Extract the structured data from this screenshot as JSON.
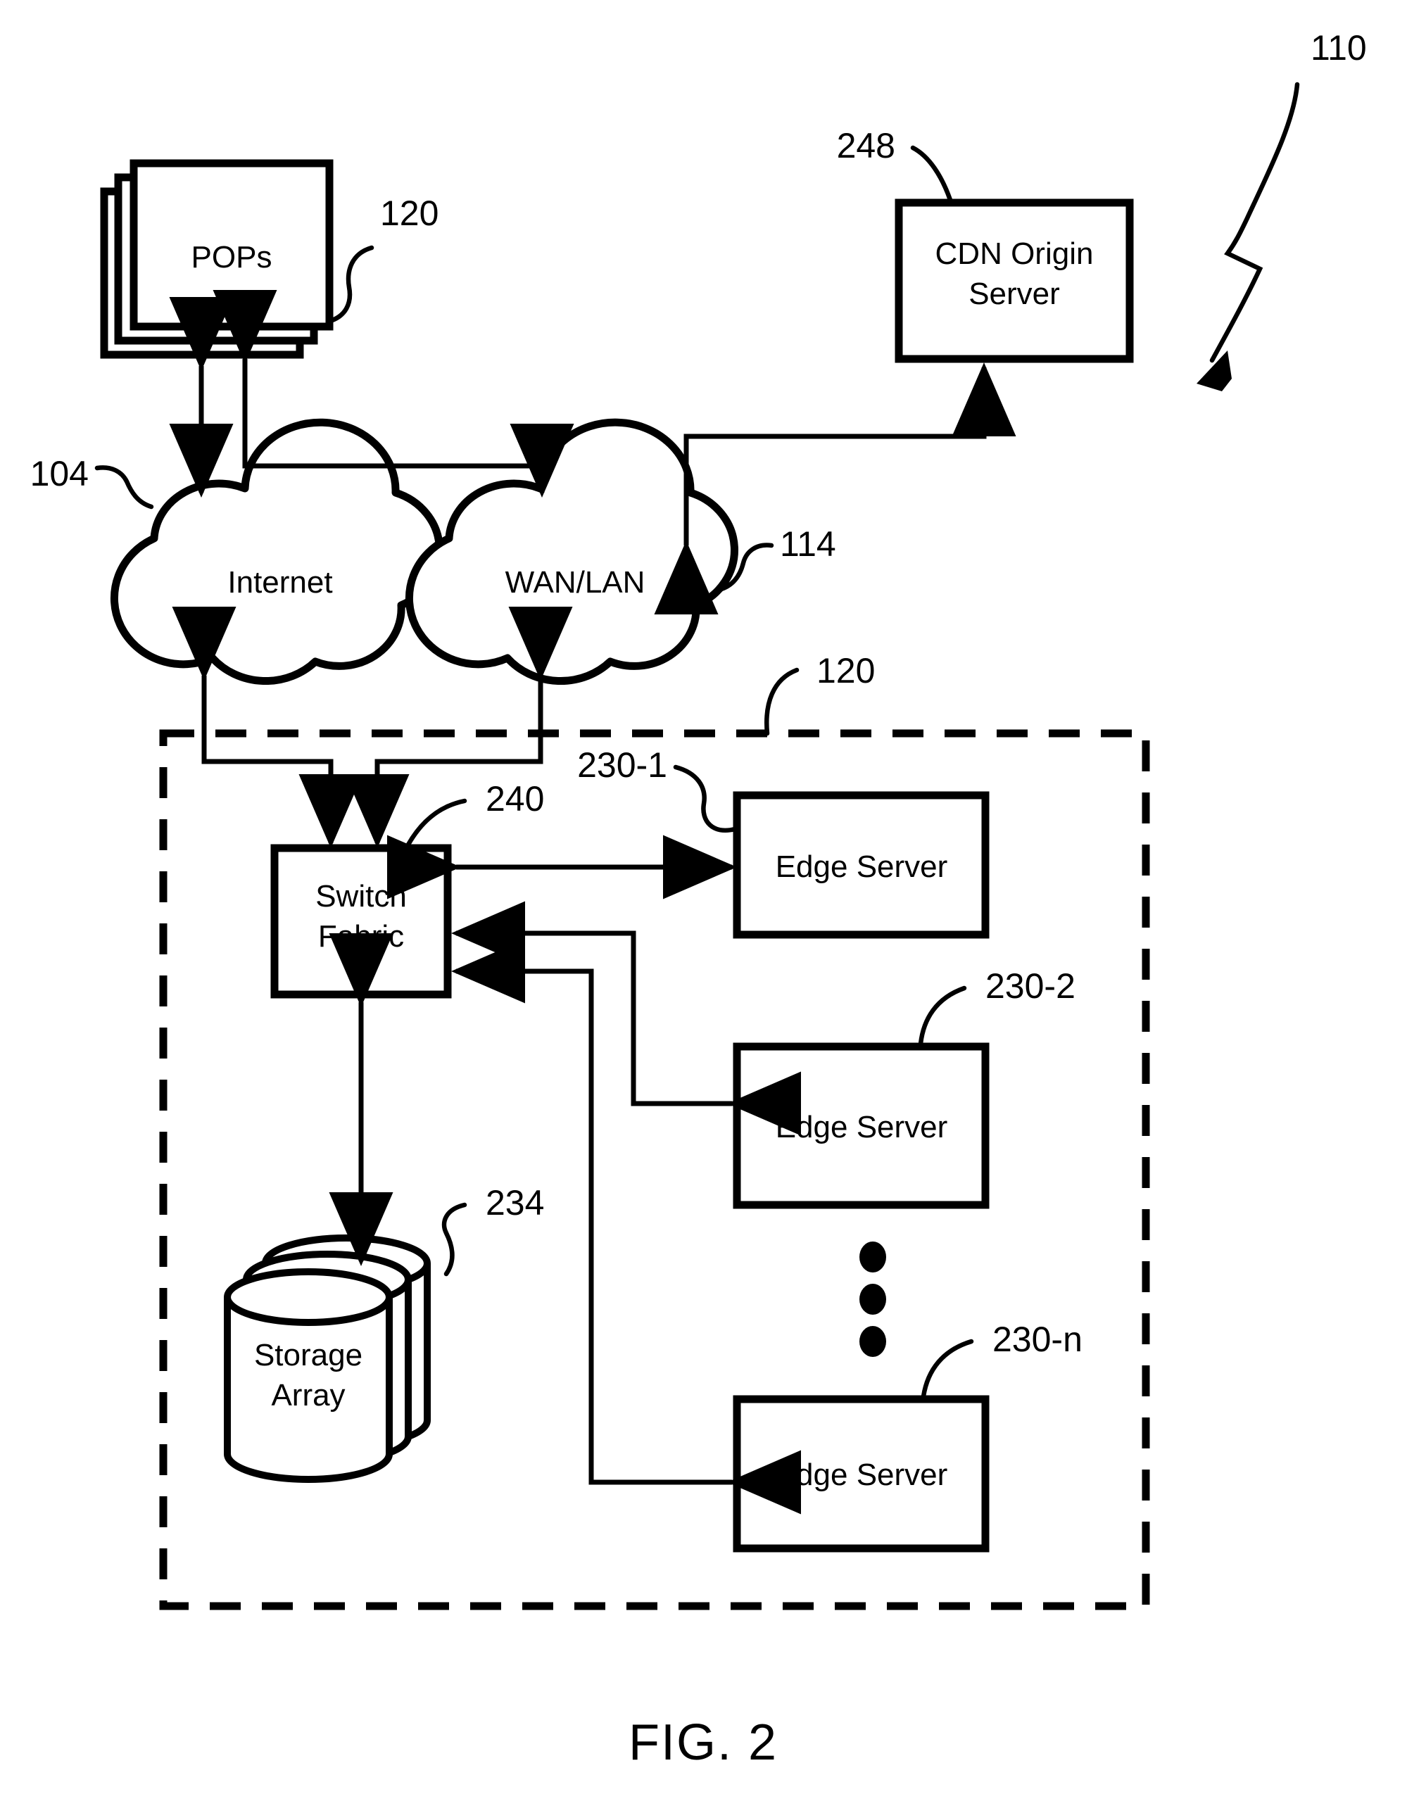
{
  "figure": {
    "caption": "FIG. 2",
    "system_ref": "110"
  },
  "nodes": {
    "pops": {
      "label": "POPs",
      "ref": "120"
    },
    "cdn_origin": {
      "label_line1": "CDN Origin",
      "label_line2": "Server",
      "ref": "248"
    },
    "internet": {
      "label": "Internet",
      "ref": "104"
    },
    "wan_lan": {
      "label": "WAN/LAN",
      "ref": "114"
    },
    "pop_boundary": {
      "ref": "120"
    },
    "switch_fabric": {
      "label_line1": "Switch",
      "label_line2": "Fabric",
      "ref": "240"
    },
    "storage_array": {
      "label_line1": "Storage",
      "label_line2": "Array",
      "ref": "234"
    },
    "edge_servers": [
      {
        "label": "Edge Server",
        "ref": "230-1"
      },
      {
        "label": "Edge Server",
        "ref": "230-2"
      },
      {
        "label": "Edge Server",
        "ref": "230-n"
      }
    ],
    "ellipsis": {
      "name": "vertical-ellipsis",
      "count": 3
    }
  },
  "colors": {
    "ink": "#000000",
    "paper": "#ffffff"
  }
}
